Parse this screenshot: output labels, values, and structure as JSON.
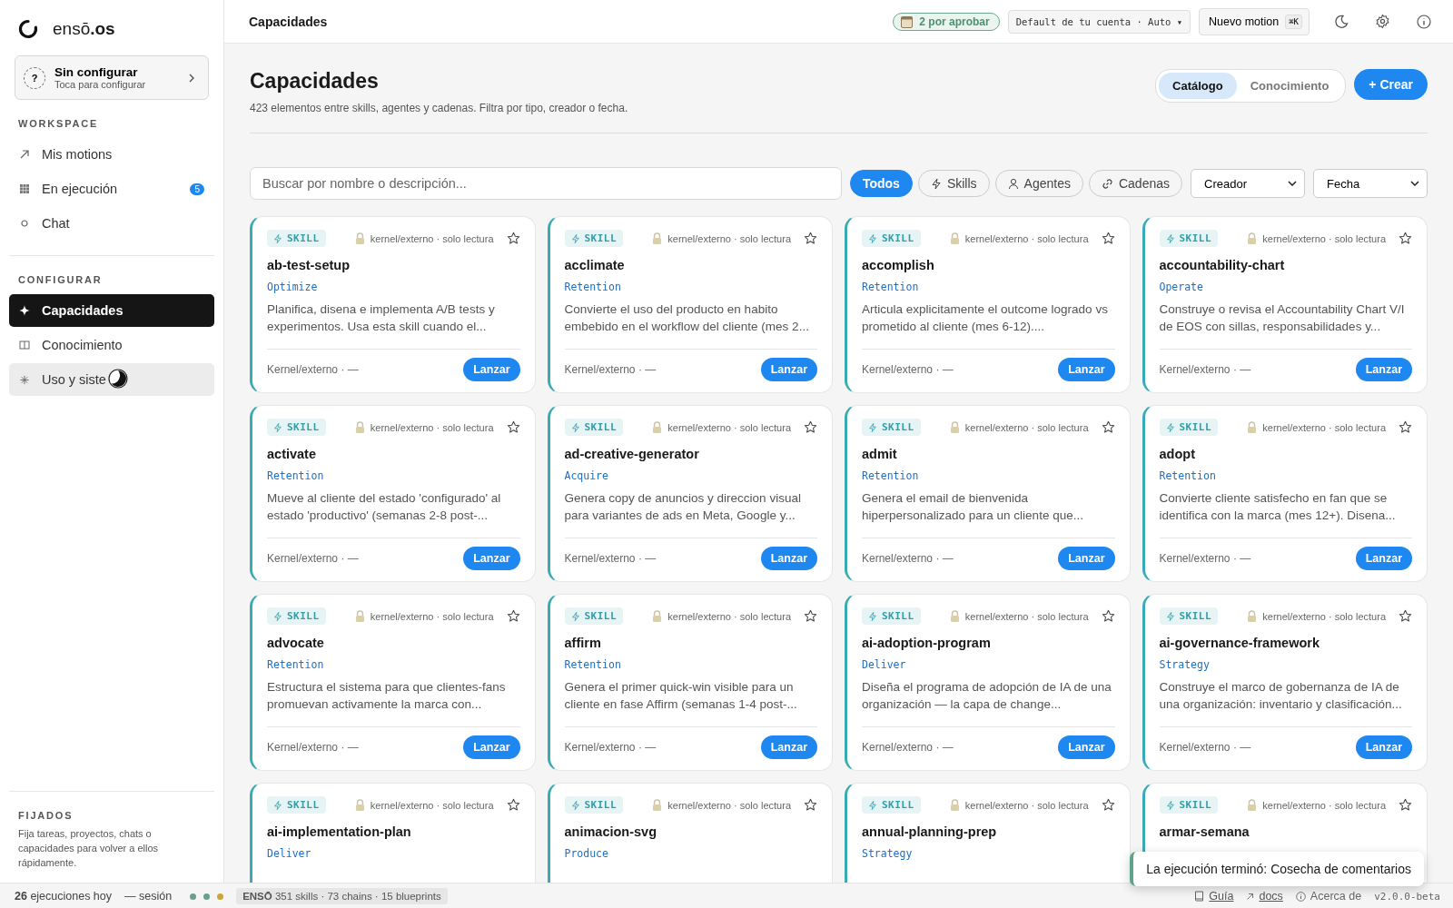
{
  "sidebar": {
    "logo": "ensō**.os**",
    "setup_card": {
      "icon_text": "?",
      "title": "Sin configurar",
      "subtitle": "Toca para configurar"
    },
    "sections": [
      {
        "title": "WORKSPACE",
        "items": [
          {
            "label": "Mis motions",
            "kind": "arrow",
            "selected": false,
            "hovered": false
          },
          {
            "label": "En ejecución",
            "kind": "grid",
            "count": "5",
            "selected": false,
            "hovered": false
          },
          {
            "label": "Chat",
            "kind": "circle",
            "selected": false,
            "hovered": false
          }
        ]
      },
      {
        "title": "CONFIGURAR",
        "items": [
          {
            "label": "Capacidades",
            "kind": "sparkle",
            "selected": true,
            "hovered": false
          },
          {
            "label": "Conocimiento",
            "kind": "book",
            "selected": false,
            "hovered": false
          },
          {
            "label": "Uso y siste",
            "kind": "asterisk",
            "selected": false,
            "hovered": true
          }
        ]
      }
    ],
    "pinned": {
      "title": "FIJADOS",
      "text": "Fija tareas, proyectos, chats o capacidades para volver a ellos rápidamente."
    }
  },
  "topbar": {
    "title": "Capacidades",
    "approval_badge": "2 por aprobar",
    "model_select": "Default de tu cuenta · Auto ▾",
    "new_button": "Nuevo motion",
    "shortcut": "⌘K"
  },
  "header": {
    "title": "Capacidades",
    "subtitle": "423 elementos entre skills, agentes y cadenas. Filtra por tipo, creador o fecha.",
    "views": [
      {
        "label": "Catálogo",
        "selected": true
      },
      {
        "label": "Conocimiento",
        "selected": false
      }
    ],
    "create_button": "+ Crear"
  },
  "filters": {
    "search": {
      "placeholder": "Buscar por nombre o descripción..."
    },
    "chips": [
      {
        "label": "Todos",
        "kind": "plain",
        "selected": true
      },
      {
        "label": "Skills",
        "kind": "bolt",
        "selected": false
      },
      {
        "label": "Agentes",
        "kind": "person",
        "selected": false
      },
      {
        "label": "Cadenas",
        "kind": "link",
        "selected": false
      }
    ],
    "selects": [
      "Creador",
      "Fecha"
    ]
  },
  "cards": [
    {
      "badge": "SKILL",
      "meta": "kernel/externo · solo lectura",
      "title": "ab-test-setup",
      "category": "Optimize",
      "description": "Planifica, disena e implementa A/B tests y experimentos. Usa esta skill cuando el...",
      "footer": "Kernel/externo · —",
      "button": "Lanzar"
    },
    {
      "badge": "SKILL",
      "meta": "kernel/externo · solo lectura",
      "title": "acclimate",
      "category": "Retention",
      "description": "Convierte el uso del producto en habito embebido en el workflow del cliente (mes 2...",
      "footer": "Kernel/externo · —",
      "button": "Lanzar"
    },
    {
      "badge": "SKILL",
      "meta": "kernel/externo · solo lectura",
      "title": "accomplish",
      "category": "Retention",
      "description": "Articula explicitamente el outcome logrado vs prometido al cliente (mes 6-12)....",
      "footer": "Kernel/externo · —",
      "button": "Lanzar"
    },
    {
      "badge": "SKILL",
      "meta": "kernel/externo · solo lectura",
      "title": "accountability-chart",
      "category": "Operate",
      "description": "Construye o revisa el Accountability Chart V/I de EOS con sillas, responsabilidades y...",
      "footer": "Kernel/externo · —",
      "button": "Lanzar"
    },
    {
      "badge": "SKILL",
      "meta": "kernel/externo · solo lectura",
      "title": "activate",
      "category": "Retention",
      "description": "Mueve al cliente del estado 'configurado' al estado 'productivo' (semanas 2-8 post-...",
      "footer": "Kernel/externo · —",
      "button": "Lanzar"
    },
    {
      "badge": "SKILL",
      "meta": "kernel/externo · solo lectura",
      "title": "ad-creative-generator",
      "category": "Acquire",
      "description": "Genera copy de anuncios y direccion visual para variantes de ads en Meta, Google y...",
      "footer": "Kernel/externo · —",
      "button": "Lanzar"
    },
    {
      "badge": "SKILL",
      "meta": "kernel/externo · solo lectura",
      "title": "admit",
      "category": "Retention",
      "description": "Genera el email de bienvenida hiperpersonalizado para un cliente que...",
      "footer": "Kernel/externo · —",
      "button": "Lanzar"
    },
    {
      "badge": "SKILL",
      "meta": "kernel/externo · solo lectura",
      "title": "adopt",
      "category": "Retention",
      "description": "Convierte cliente satisfecho en fan que se identifica con la marca (mes 12+). Disena...",
      "footer": "Kernel/externo · —",
      "button": "Lanzar"
    },
    {
      "badge": "SKILL",
      "meta": "kernel/externo · solo lectura",
      "title": "advocate",
      "category": "Retention",
      "description": "Estructura el sistema para que clientes-fans promuevan activamente la marca con...",
      "footer": "Kernel/externo · —",
      "button": "Lanzar"
    },
    {
      "badge": "SKILL",
      "meta": "kernel/externo · solo lectura",
      "title": "affirm",
      "category": "Retention",
      "description": "Genera el primer quick-win visible para un cliente en fase Affirm (semanas 1-4 post-...",
      "footer": "Kernel/externo · —",
      "button": "Lanzar"
    },
    {
      "badge": "SKILL",
      "meta": "kernel/externo · solo lectura",
      "title": "ai-adoption-program",
      "category": "Deliver",
      "description": "Diseña el programa de adopción de IA de una organización — la capa de change...",
      "footer": "Kernel/externo · —",
      "button": "Lanzar"
    },
    {
      "badge": "SKILL",
      "meta": "kernel/externo · solo lectura",
      "title": "ai-governance-framework",
      "category": "Strategy",
      "description": "Construye el marco de gobernanza de IA de una organización: inventario y clasificación...",
      "footer": "Kernel/externo · —",
      "button": "Lanzar"
    },
    {
      "badge": "SKILL",
      "meta": "kernel/externo · solo lectura",
      "title": "ai-implementation-plan",
      "category": "Deliver"
    },
    {
      "badge": "SKILL",
      "meta": "kernel/externo · solo lectura",
      "title": "animacion-svg",
      "category": "Produce"
    },
    {
      "badge": "SKILL",
      "meta": "kernel/externo · solo lectura",
      "title": "annual-planning-prep",
      "category": "Strategy"
    },
    {
      "badge": "SKILL",
      "meta": "kernel/externo · solo lectura",
      "title": "armar-semana"
    }
  ],
  "toast": "La ejecución terminó: Cosecha de comentarios",
  "status_bar": {
    "runs": "**26** ejecuciones hoy",
    "session": "— sesión",
    "dots": [
      {
        "color": "#6b9e8c"
      },
      {
        "color": "#6b9e8c"
      },
      {
        "color": "#c9a636"
      }
    ],
    "stats": "**ENSŌ** 351 skills · 73 chains · 15 blueprints",
    "links": [
      {
        "label": "Guía",
        "kind": "book"
      },
      {
        "label": "docs",
        "kind": "arrow"
      }
    ],
    "about": "Acerca de",
    "version": "v2.0.0-beta"
  }
}
